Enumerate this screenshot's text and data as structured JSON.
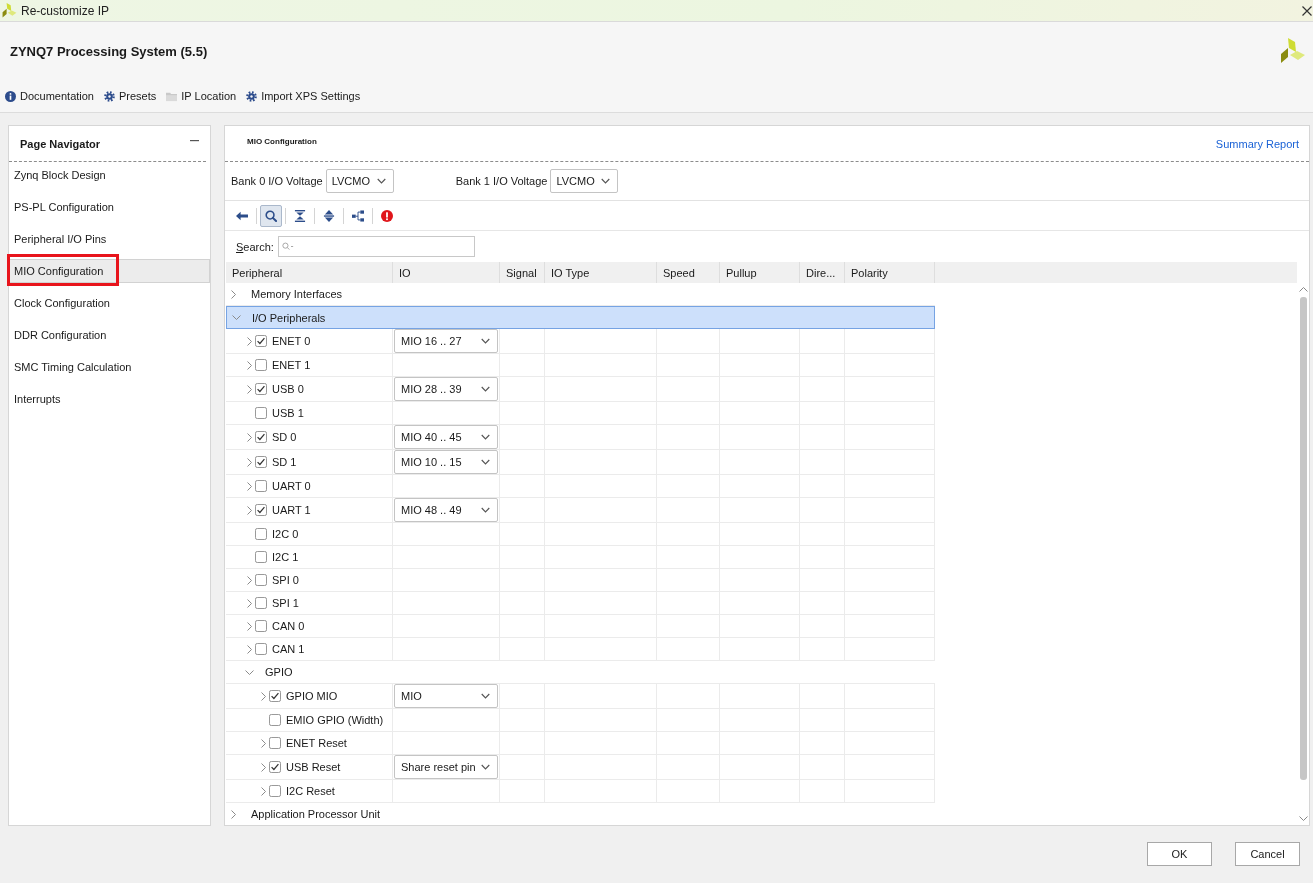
{
  "window": {
    "title": "Re-customize IP"
  },
  "header": {
    "title": "ZYNQ7 Processing System (5.5)",
    "links": [
      {
        "kind": "help",
        "label": "Documentation"
      },
      {
        "kind": "preset",
        "label": "Presets"
      },
      {
        "kind": "location",
        "label": "IP Location"
      },
      {
        "kind": "import",
        "label": "Import XPS Settings"
      }
    ]
  },
  "navigator": {
    "title": "Page Navigator",
    "items": [
      {
        "label": "Zynq Block Design",
        "selected": false,
        "highlighted": false
      },
      {
        "label": "PS-PL Configuration",
        "selected": false,
        "highlighted": false
      },
      {
        "label": "Peripheral I/O Pins",
        "selected": false,
        "highlighted": false
      },
      {
        "label": "MIO Configuration",
        "selected": true,
        "highlighted": true
      },
      {
        "label": "Clock Configuration",
        "selected": false,
        "highlighted": false
      },
      {
        "label": "DDR Configuration",
        "selected": false,
        "highlighted": false
      },
      {
        "label": "SMC Timing Calculation",
        "selected": false,
        "highlighted": false
      },
      {
        "label": "Interrupts",
        "selected": false,
        "highlighted": false
      }
    ]
  },
  "page": {
    "title": "MIO Configuration",
    "summary_link": "Summary Report",
    "bank_voltages": [
      {
        "label": "Bank 0 I/O Voltage",
        "value": "LVCMO"
      },
      {
        "label": "Bank 1 I/O Voltage",
        "value": "LVCMO"
      }
    ],
    "tools": [
      {
        "kind": "back",
        "selected": false
      },
      {
        "kind": "search",
        "selected": true
      },
      {
        "kind": "collapse",
        "selected": false
      },
      {
        "kind": "expand",
        "selected": false
      },
      {
        "kind": "hierarchy",
        "selected": false
      },
      {
        "kind": "error",
        "selected": false
      }
    ],
    "search": {
      "label": "Search:"
    },
    "table": {
      "columns": [
        "Peripheral",
        "IO",
        "Signal",
        "IO Type",
        "Speed",
        "Pullup",
        "Dire...",
        "Polarity"
      ],
      "rows": [
        {
          "kind": "group",
          "label": "Memory Interfaces",
          "expanded": false,
          "selected": false
        },
        {
          "kind": "group",
          "label": "I/O Peripherals",
          "expanded": true,
          "selected": true,
          "children": [
            {
              "kind": "peripheral",
              "label": "ENET 0",
              "expandable": true,
              "selected": false,
              "checked": true,
              "io": "MIO 16 .. 27"
            },
            {
              "kind": "peripheral",
              "label": "ENET 1",
              "expandable": true,
              "selected": false,
              "checked": false
            },
            {
              "kind": "peripheral",
              "label": "USB 0",
              "expandable": true,
              "selected": false,
              "checked": true,
              "io": "MIO 28 .. 39"
            },
            {
              "kind": "peripheral",
              "label": "USB 1",
              "expandable": false,
              "selected": false,
              "checked": false
            },
            {
              "kind": "peripheral",
              "label": "SD 0",
              "expandable": true,
              "selected": false,
              "checked": true,
              "io": "MIO 40 .. 45"
            },
            {
              "kind": "peripheral",
              "label": "SD 1",
              "expandable": true,
              "selected": false,
              "checked": true,
              "io": "MIO 10 .. 15"
            },
            {
              "kind": "peripheral",
              "label": "UART 0",
              "expandable": true,
              "selected": false,
              "checked": false
            },
            {
              "kind": "peripheral",
              "label": "UART 1",
              "expandable": true,
              "selected": false,
              "checked": true,
              "io": "MIO 48 .. 49"
            },
            {
              "kind": "peripheral",
              "label": "I2C 0",
              "expandable": false,
              "selected": false,
              "checked": false
            },
            {
              "kind": "peripheral",
              "label": "I2C 1",
              "expandable": false,
              "selected": false,
              "checked": false
            },
            {
              "kind": "peripheral",
              "label": "SPI 0",
              "expandable": true,
              "selected": false,
              "checked": false
            },
            {
              "kind": "peripheral",
              "label": "SPI 1",
              "expandable": true,
              "selected": false,
              "checked": false
            },
            {
              "kind": "peripheral",
              "label": "CAN 0",
              "expandable": true,
              "selected": false,
              "checked": false
            },
            {
              "kind": "peripheral",
              "label": "CAN 1",
              "expandable": true,
              "selected": false,
              "checked": false
            },
            {
              "kind": "group",
              "label": "GPIO",
              "expanded": true,
              "selected": false,
              "children": [
                {
                  "kind": "peripheral",
                  "label": "GPIO MIO",
                  "expandable": true,
                  "selected": false,
                  "checked": true,
                  "io": "MIO"
                },
                {
                  "kind": "peripheral",
                  "label": "EMIO GPIO (Width)",
                  "expandable": false,
                  "selected": false,
                  "checked": false
                },
                {
                  "kind": "peripheral",
                  "label": "ENET Reset",
                  "expandable": true,
                  "selected": false,
                  "checked": false
                },
                {
                  "kind": "peripheral",
                  "label": "USB Reset",
                  "expandable": true,
                  "selected": false,
                  "checked": true,
                  "io": "Share reset pin"
                },
                {
                  "kind": "peripheral",
                  "label": "I2C Reset",
                  "expandable": true,
                  "selected": false,
                  "checked": false
                }
              ]
            }
          ]
        },
        {
          "kind": "group",
          "label": "Application Processor Unit",
          "expanded": false,
          "selected": false
        }
      ]
    }
  },
  "buttons": [
    "OK",
    "Cancel"
  ]
}
